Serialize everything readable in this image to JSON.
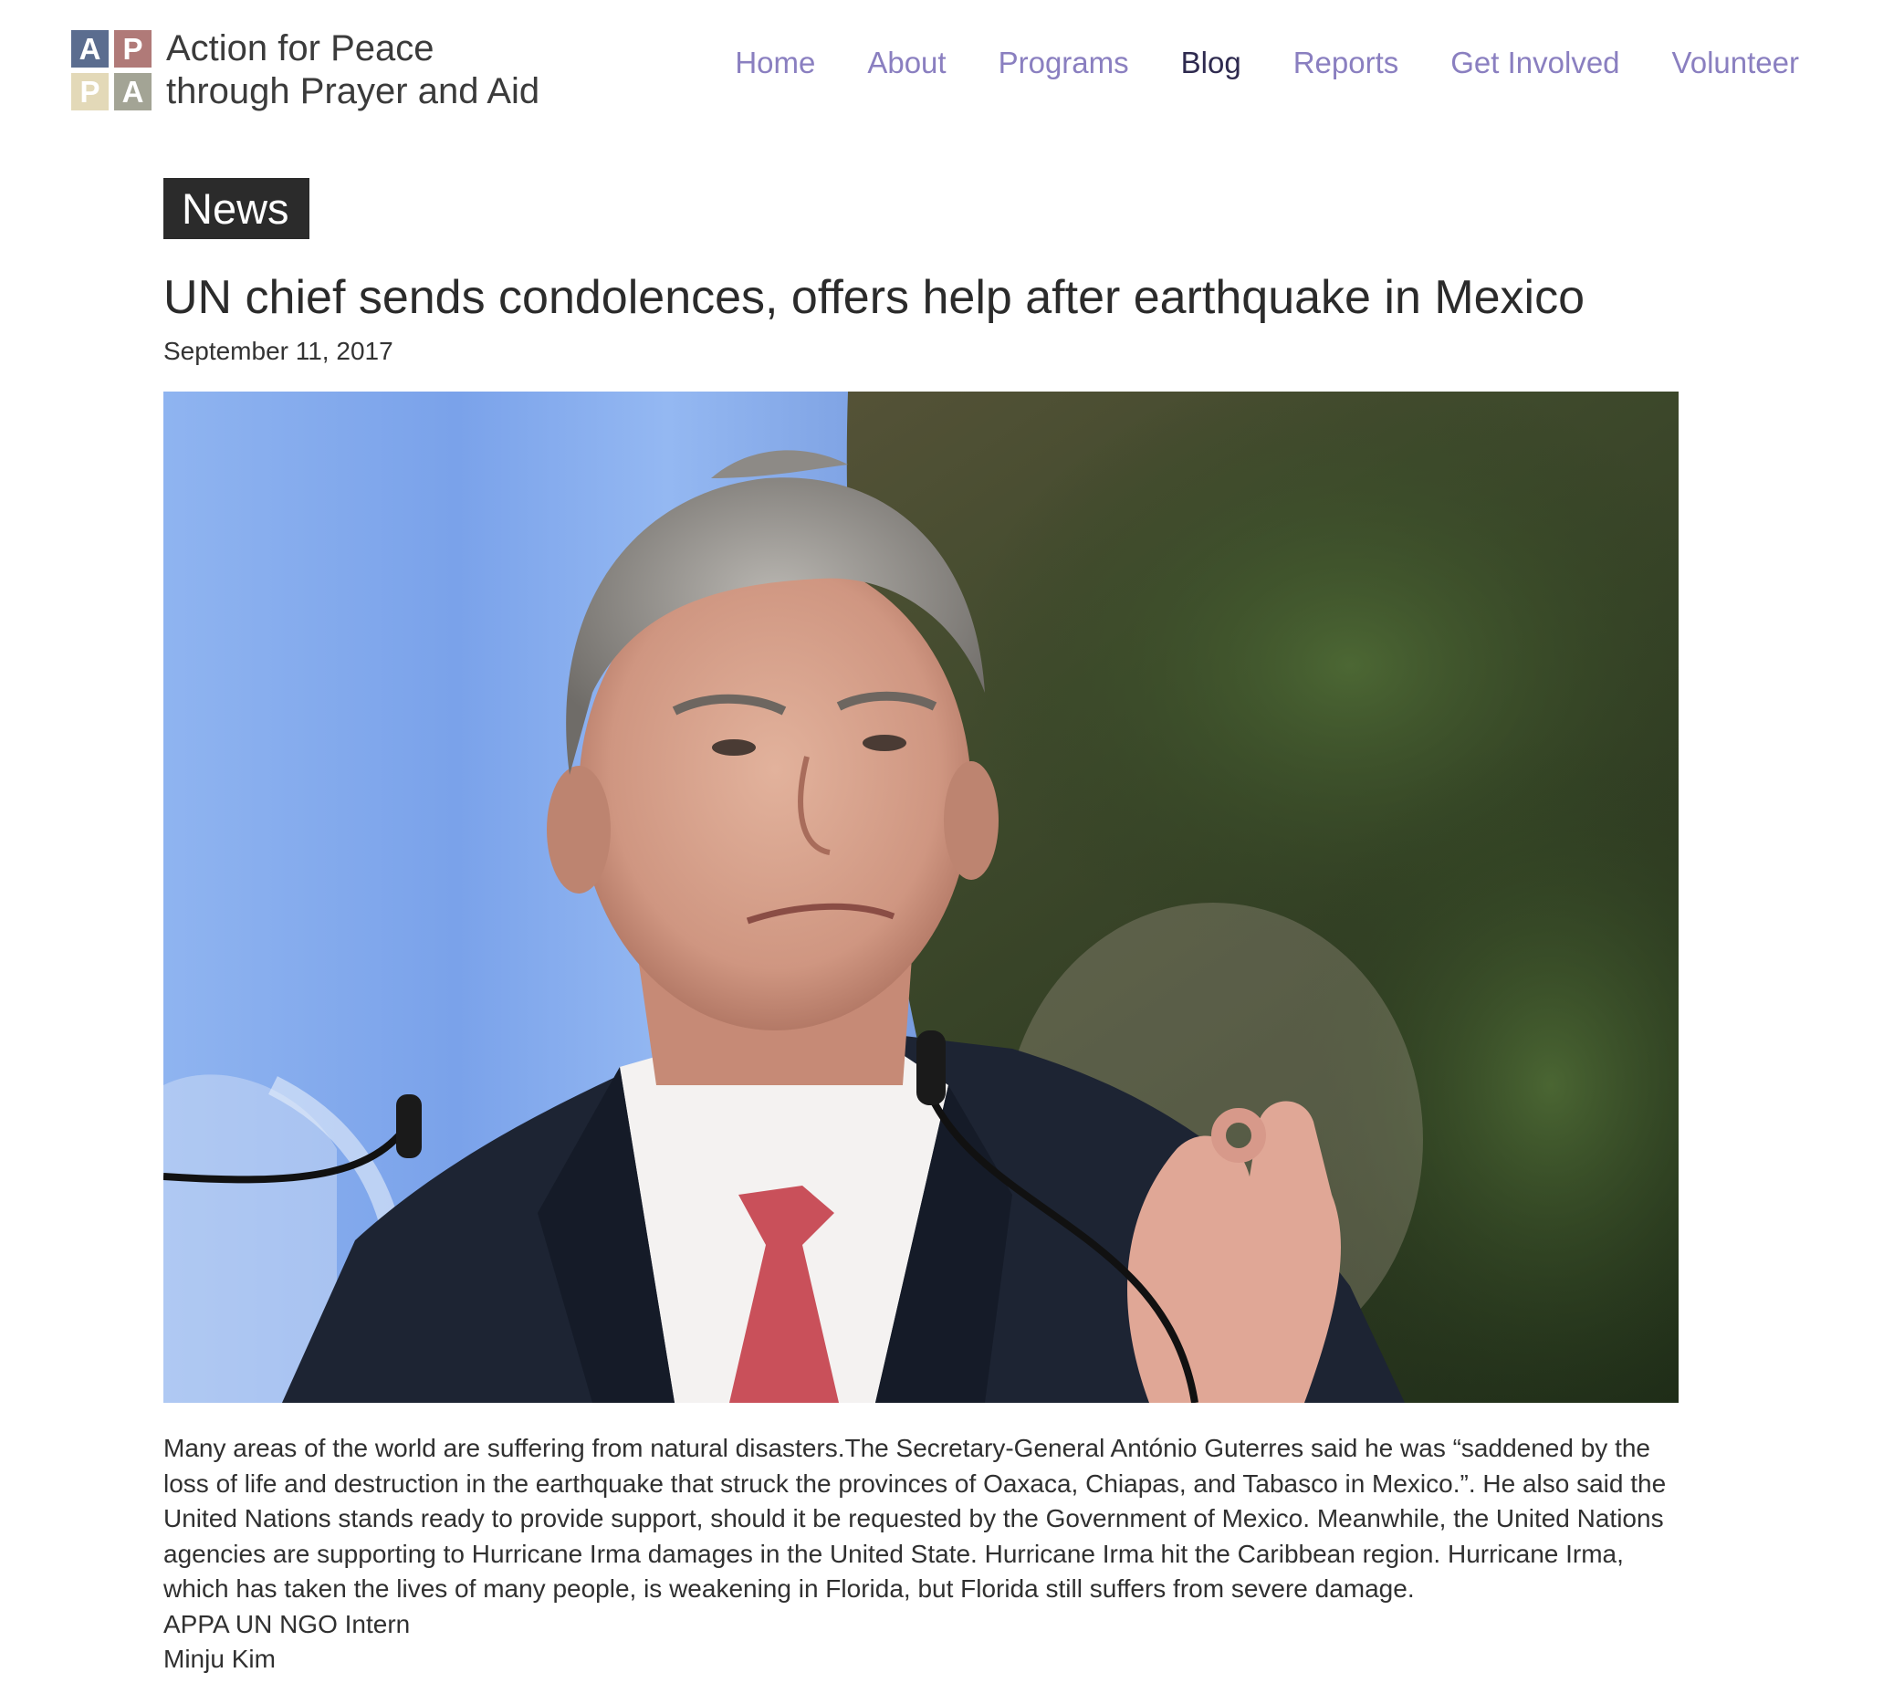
{
  "logo": {
    "letters": [
      "A",
      "P",
      "P",
      "A"
    ],
    "tile_colors": [
      "#5b6d8f",
      "#b07a78",
      "#e3d9b8",
      "#a3a495"
    ],
    "line1": "Action for Peace",
    "line2": "through Prayer and Aid"
  },
  "nav": {
    "items": [
      "Home",
      "About",
      "Programs",
      "Blog",
      "Reports",
      "Get Involved",
      "Volunteer"
    ],
    "active": "Blog",
    "link_color": "#8a7fc0",
    "active_color": "#2e2a4f"
  },
  "article": {
    "category": "News",
    "title": "UN chief sends condolences, offers help after earthquake in Mexico",
    "date": "September 11, 2017",
    "image_alt": "António Guterres speaking at a podium",
    "body": "Many areas of the world are suffering from natural disasters.The Secretary-General António Guterres said he was “saddened by the loss of life and destruction in the earthquake that struck the provinces of Oaxaca, Chiapas, and Tabasco in Mexico.”. He also said the United Nations stands ready to provide support, should it be requested by the Government of Mexico. Meanwhile, the United Nations agencies are supporting to Hurricane Irma damages in the United State. Hurricane Irma hit the Caribbean region. Hurricane Irma, which has taken the lives of many people, is weakening in Florida, but Florida still suffers from severe damage.",
    "author_role": "APPA UN NGO Intern",
    "author_name": "Minju Kim"
  }
}
